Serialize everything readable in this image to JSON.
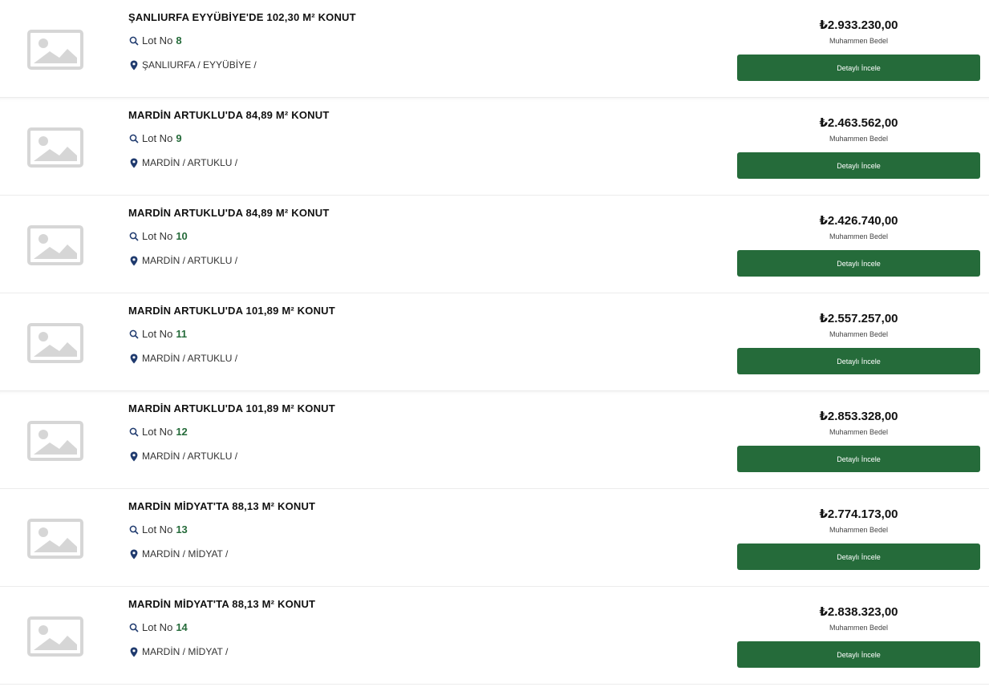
{
  "listings": [
    {
      "title": "ŞANLIURFA EYYÜBİYE'DE 102,30 M² KONUT",
      "lot_label": "Lot No",
      "lot_no": "8",
      "location": "ŞANLIURFA / EYYÜBİYE /",
      "price": "₺2.933.230,00",
      "price_label": "Muhammen Bedel",
      "button_label": "Detaylı İncele"
    },
    {
      "title": "MARDİN ARTUKLU'DA 84,89 M² KONUT",
      "lot_label": "Lot No",
      "lot_no": "9",
      "location": "MARDİN / ARTUKLU /",
      "price": "₺2.463.562,00",
      "price_label": "Muhammen Bedel",
      "button_label": "Detaylı İncele"
    },
    {
      "title": "MARDİN ARTUKLU'DA 84,89 M² KONUT",
      "lot_label": "Lot No",
      "lot_no": "10",
      "location": "MARDİN / ARTUKLU /",
      "price": "₺2.426.740,00",
      "price_label": "Muhammen Bedel",
      "button_label": "Detaylı İncele"
    },
    {
      "title": "MARDİN ARTUKLU'DA 101,89 M² KONUT",
      "lot_label": "Lot No",
      "lot_no": "11",
      "location": "MARDİN / ARTUKLU /",
      "price": "₺2.557.257,00",
      "price_label": "Muhammen Bedel",
      "button_label": "Detaylı İncele"
    },
    {
      "title": "MARDİN ARTUKLU'DA 101,89 M² KONUT",
      "lot_label": "Lot No",
      "lot_no": "12",
      "location": "MARDİN / ARTUKLU /",
      "price": "₺2.853.328,00",
      "price_label": "Muhammen Bedel",
      "button_label": "Detaylı İncele"
    },
    {
      "title": "MARDİN MİDYAT'TA 88,13 M² KONUT",
      "lot_label": "Lot No",
      "lot_no": "13",
      "location": "MARDİN / MİDYAT /",
      "price": "₺2.774.173,00",
      "price_label": "Muhammen Bedel",
      "button_label": "Detaylı İncele"
    },
    {
      "title": "MARDİN MİDYAT'TA 88,13 M² KONUT",
      "lot_label": "Lot No",
      "lot_no": "14",
      "location": "MARDİN / MİDYAT /",
      "price": "₺2.838.323,00",
      "price_label": "Muhammen Bedel",
      "button_label": "Detaylı İncele"
    }
  ],
  "colors": {
    "accent": "#256b3a",
    "placeholder": "#d9d9d9",
    "pin": "#1f3a6e"
  },
  "icons": {
    "thumbnail": "image-placeholder-icon",
    "lot": "search-icon",
    "location": "map-pin-icon"
  }
}
